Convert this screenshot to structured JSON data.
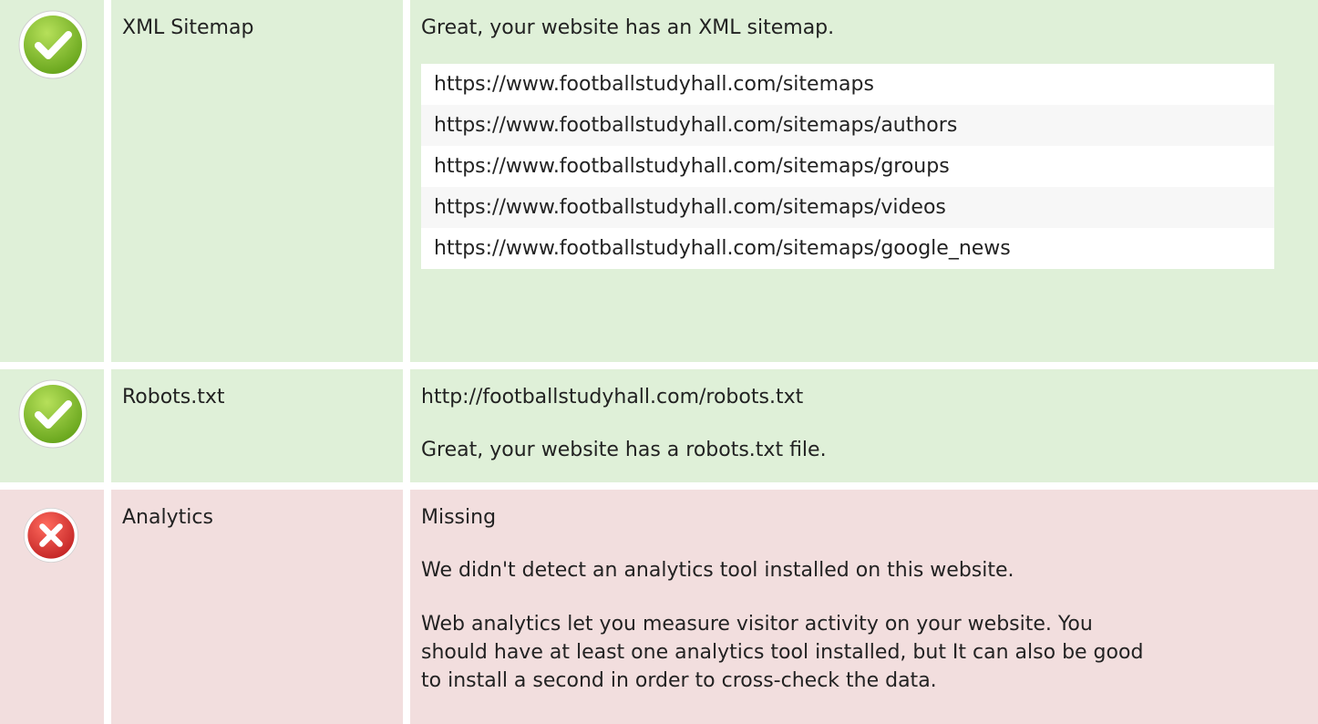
{
  "colors": {
    "pass_bg": "#dff0d8",
    "fail_bg": "#f2dede",
    "pass_icon": "#8cc63f",
    "fail_icon": "#e53935"
  },
  "sitemap": {
    "icon": "check-icon",
    "label": "XML Sitemap",
    "message": "Great, your website has an XML sitemap.",
    "urls": [
      "https://www.footballstudyhall.com/sitemaps",
      "https://www.footballstudyhall.com/sitemaps/authors",
      "https://www.footballstudyhall.com/sitemaps/groups",
      "https://www.footballstudyhall.com/sitemaps/videos",
      "https://www.footballstudyhall.com/sitemaps/google_news"
    ]
  },
  "robots": {
    "icon": "check-icon",
    "label": "Robots.txt",
    "url": "http://footballstudyhall.com/robots.txt",
    "message": "Great, your website has a robots.txt file."
  },
  "analytics": {
    "icon": "cross-icon",
    "label": "Analytics",
    "status": "Missing",
    "message": "We didn't detect an analytics tool installed on this website.",
    "details": "Web analytics let you measure visitor activity on your website. You should have at least one analytics tool installed, but It can also be good to install a second in order to cross-check the data."
  }
}
